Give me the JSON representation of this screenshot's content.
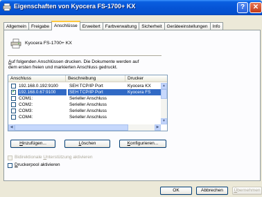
{
  "window": {
    "title": "Eigenschaften von Kyocera FS-1700+ KX",
    "help_label": "?",
    "close_label": "✕"
  },
  "tabs": [
    {
      "label": "Allgemein"
    },
    {
      "label": "Freigabe"
    },
    {
      "label": "Anschlüsse",
      "active": true
    },
    {
      "label": "Erweitert"
    },
    {
      "label": "Farbverwaltung"
    },
    {
      "label": "Sicherheit"
    },
    {
      "label": "Geräteeinstellungen"
    },
    {
      "label": "Info"
    }
  ],
  "printer": {
    "name": "Kyocera FS-1700+ KX",
    "icon": "printer-icon"
  },
  "description": {
    "line1_underlined": "A",
    "line1_rest": "uf folgenden Anschlüssen drucken. Die Dokumente werden auf",
    "line2": "dem ersten freien und markierten Anschluss gedruckt."
  },
  "port_list": {
    "columns": [
      "Anschluss",
      "Beschreibung",
      "Drucker"
    ],
    "rows": [
      {
        "checked": false,
        "port": "192.168.0.192:9100",
        "description": "SEH TCP/IP Port",
        "printer": "Kyocera KX"
      },
      {
        "checked": true,
        "selected": true,
        "port": "192.168.0.67:9100",
        "description": "SEH TCP/IP Port",
        "printer": "Kyocera FS"
      },
      {
        "checked": false,
        "port": "COM1:",
        "description": "Serieller Anschluss",
        "printer": ""
      },
      {
        "checked": false,
        "port": "COM2:",
        "description": "Serieller Anschluss",
        "printer": ""
      },
      {
        "checked": false,
        "port": "COM3:",
        "description": "Serieller Anschluss",
        "printer": ""
      },
      {
        "checked": false,
        "port": "COM4:",
        "description": "Serieller Anschluss",
        "printer": ""
      }
    ]
  },
  "buttons": {
    "add": {
      "underlined": "H",
      "rest": "inzufügen..."
    },
    "delete": {
      "underlined": "L",
      "rest": "öschen"
    },
    "configure": {
      "underlined": "K",
      "rest": "onfigurieren..."
    }
  },
  "options": {
    "bidi": {
      "pre": "Bidirektionale ",
      "underlined": "U",
      "rest": "nterstützung aktivieren",
      "checked": false,
      "enabled": false
    },
    "pool": {
      "underlined": "D",
      "rest": "ruckerpool aktivieren",
      "checked": false,
      "enabled": true
    }
  },
  "footer": {
    "ok": "OK",
    "cancel": "Abbrechen",
    "apply_underlined": "Ü",
    "apply_rest": "bernehmen"
  }
}
